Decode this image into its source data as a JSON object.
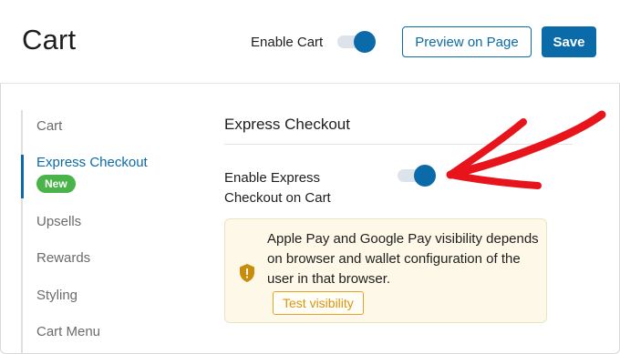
{
  "header": {
    "title": "Cart",
    "enable_cart_label": "Enable Cart",
    "enable_cart_on": true,
    "preview_label": "Preview on Page",
    "save_label": "Save"
  },
  "sidebar": {
    "items": [
      {
        "label": "Cart",
        "active": false
      },
      {
        "label": "Express Checkout",
        "active": true,
        "badge": "New"
      },
      {
        "label": "Upsells",
        "active": false
      },
      {
        "label": "Rewards",
        "active": false
      },
      {
        "label": "Styling",
        "active": false
      },
      {
        "label": "Cart Menu",
        "active": false
      }
    ]
  },
  "main": {
    "section_title": "Express Checkout",
    "express_label": "Enable Express Checkout on Cart",
    "express_on": true,
    "notice": {
      "icon": "shield-icon",
      "text": "Apple Pay and Google Pay visibility depends on browser and wallet configuration of the user in that browser.",
      "button_label": "Test visibility"
    }
  },
  "colors": {
    "accent": "#0b6ba8",
    "badge": "#4ab44a",
    "notice_bg": "#fdf8e8",
    "notice_button": "#e3a423",
    "annotation_arrow": "#e8141c"
  }
}
